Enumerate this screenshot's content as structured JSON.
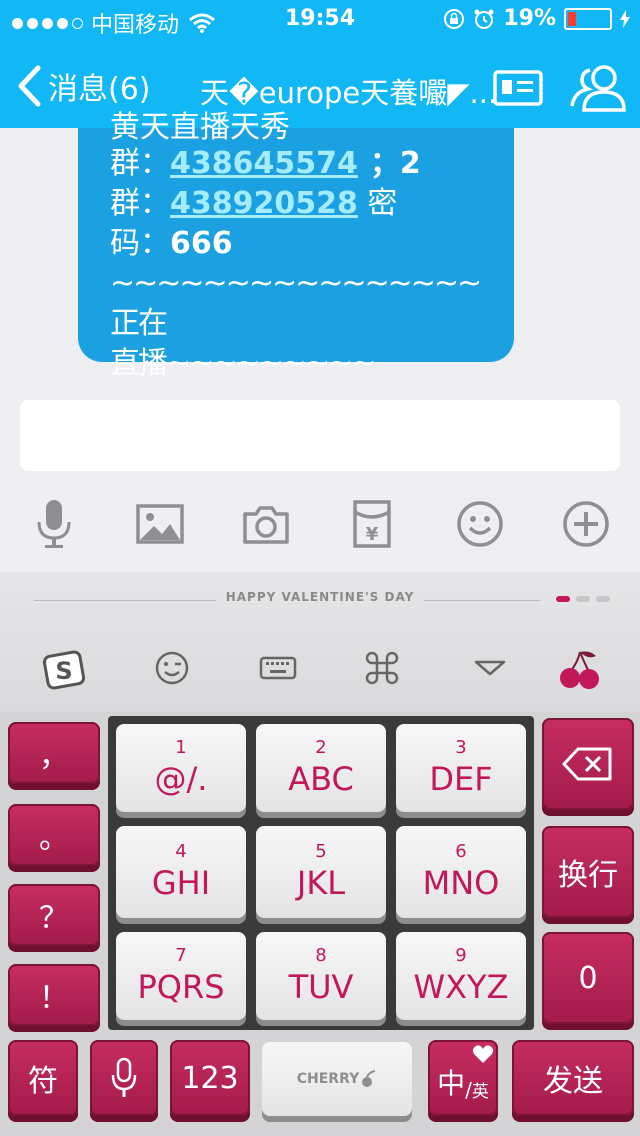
{
  "status_bar": {
    "carrier": "中国移动",
    "time": "19:54",
    "battery": "19%",
    "battery_level": 0.19
  },
  "nav": {
    "back_label": "消息(6)",
    "chat_title": "天�europe天養㘙◤..."
  },
  "message": {
    "partial_top": "黄天直播天秀",
    "line1_prefix": "群：",
    "group1": "438645574",
    "line1_suffix": "；2",
    "line2_prefix": "群：",
    "group2": "438920528",
    "line2_suffix": " 密",
    "line3": "码：",
    "password": "666",
    "line4": "~~~~~~~~~~~~~~~~正在",
    "line5": "直播~~~~~~~~~"
  },
  "toolbar": {
    "icons": [
      "microphone-icon",
      "image-icon",
      "camera-icon",
      "red-packet-icon",
      "emoji-icon",
      "add-icon"
    ]
  },
  "keyboard": {
    "banner": "HAPPY VALENTINE'S DAY",
    "accent_color": "#c2185b",
    "left_keys": [
      "，",
      "。",
      "？",
      "！"
    ],
    "grid": [
      {
        "num": "1",
        "label": "@/."
      },
      {
        "num": "2",
        "label": "ABC"
      },
      {
        "num": "3",
        "label": "DEF"
      },
      {
        "num": "4",
        "label": "GHI"
      },
      {
        "num": "5",
        "label": "JKL"
      },
      {
        "num": "6",
        "label": "MNO"
      },
      {
        "num": "7",
        "label": "PQRS"
      },
      {
        "num": "8",
        "label": "TUV"
      },
      {
        "num": "9",
        "label": "WXYZ"
      }
    ],
    "enter_label": "换行",
    "zero_label": "0",
    "symbol_label": "符",
    "num_label": "123",
    "space_brand": "CHERRY",
    "lang_main": "中",
    "lang_sub": "英",
    "send_label": "发送"
  }
}
